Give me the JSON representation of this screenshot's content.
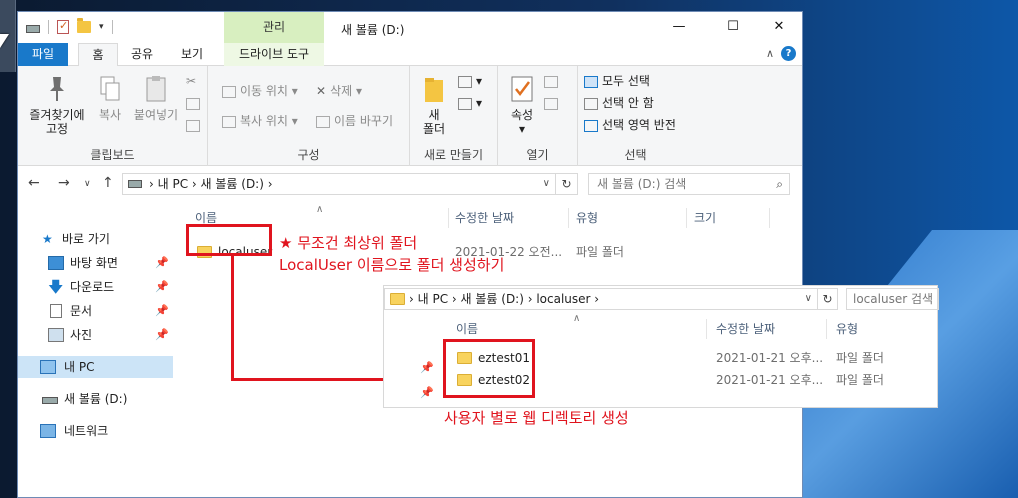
{
  "window": {
    "title": "새 볼륨 (D:)",
    "context_tab": "관리",
    "controls": {
      "minimize": "—",
      "maximize": "☐",
      "close": "✕"
    }
  },
  "tabs": {
    "file": "파일",
    "home": "홈",
    "share": "공유",
    "view": "보기",
    "drive_tools": "드라이브 도구"
  },
  "ribbon": {
    "clipboard": {
      "label": "클립보드",
      "pin": "즐겨찾기에\n고정",
      "pin_line1": "즐겨찾기에",
      "pin_line2": "고정",
      "copy": "복사",
      "paste": "붙여넣기"
    },
    "organize": {
      "label": "구성",
      "move_to": "이동 위치",
      "copy_to": "복사 위치",
      "delete": "삭제",
      "rename": "이름 바꾸기"
    },
    "new": {
      "label": "새로 만들기",
      "new_folder_line1": "새",
      "new_folder_line2": "폴더"
    },
    "open": {
      "label": "열기",
      "properties": "속성"
    },
    "select": {
      "label": "선택",
      "select_all": "모두 선택",
      "select_none": "선택 안 함",
      "invert": "선택 영역 반전"
    }
  },
  "address": {
    "path": [
      "내 PC",
      "새 볼륨 (D:)"
    ],
    "path_text": "›  내 PC  ›  새 볼륨 (D:)  ›",
    "search_placeholder": "새 볼륨 (D:) 검색"
  },
  "nav": {
    "quick_access": "바로 가기",
    "desktop": "바탕 화면",
    "downloads": "다운로드",
    "documents": "문서",
    "pictures": "사진",
    "this_pc": "내 PC",
    "drive_d": "새 볼륨 (D:)",
    "network": "네트워크"
  },
  "columns": {
    "name": "이름",
    "modified": "수정한 날짜",
    "type": "유형",
    "size": "크기"
  },
  "files": [
    {
      "name": "localuser",
      "modified": "2021-01-22 오전...",
      "type": "파일 폴더"
    }
  ],
  "annotations": {
    "star": "★",
    "note1_line1": "무조건 최상위 폴더",
    "note1_line2": "LocalUser 이름으로 폴더 생성하기",
    "note2": "사용자 별로 웹 디렉토리 생성"
  },
  "sub_window": {
    "path_text": "›  내 PC  ›  새 볼륨 (D:)  ›  localuser  ›",
    "search_placeholder": "localuser 검색",
    "columns": {
      "name": "이름",
      "modified": "수정한 날짜",
      "type": "유형"
    },
    "files": [
      {
        "name": "eztest01",
        "modified": "2021-01-21 오후...",
        "type": "파일 폴더"
      },
      {
        "name": "eztest02",
        "modified": "2021-01-21 오후...",
        "type": "파일 폴더"
      }
    ]
  },
  "colors": {
    "accent": "#1979ca",
    "annotation_red": "#e0141e",
    "context_green": "#d8efc0"
  }
}
